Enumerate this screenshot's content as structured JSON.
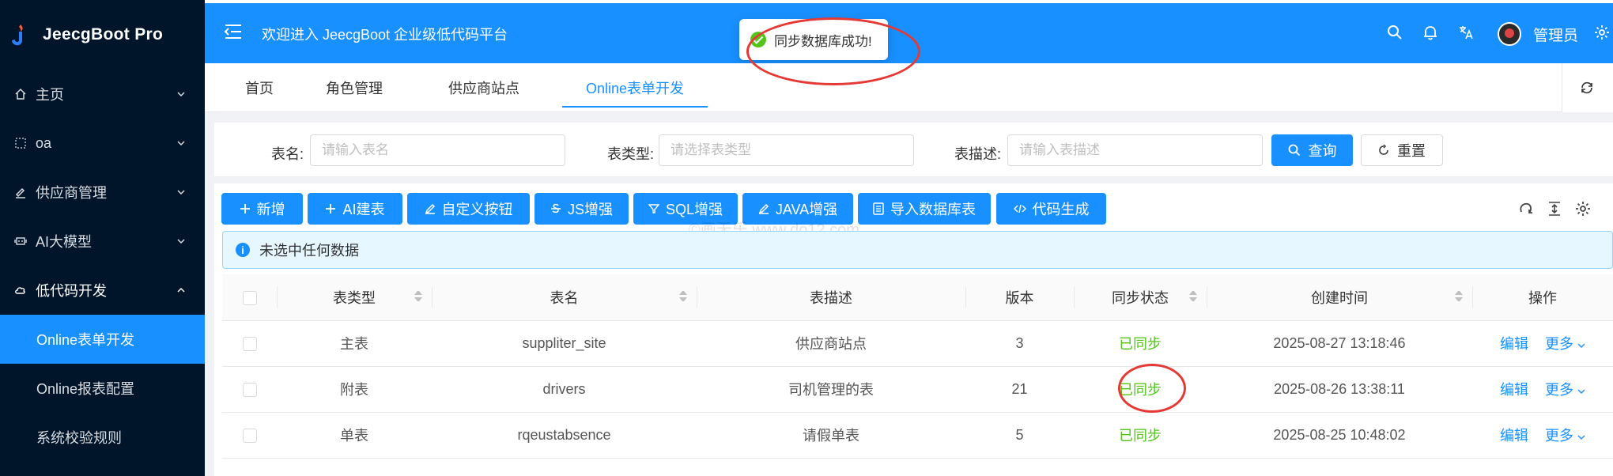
{
  "app": {
    "title": "JeecgBoot Pro",
    "welcome": "欢迎进入 JeecgBoot 企业级低代码平台",
    "user": "管理员"
  },
  "toast": {
    "message": "同步数据库成功!"
  },
  "sidebar": {
    "items": [
      {
        "label": "主页",
        "icon": "home-icon"
      },
      {
        "label": "oa",
        "icon": "grid-icon"
      },
      {
        "label": "供应商管理",
        "icon": "brush-icon"
      },
      {
        "label": "AI大模型",
        "icon": "model-icon"
      },
      {
        "label": "低代码开发",
        "icon": "cloud-icon"
      }
    ],
    "submenu": [
      {
        "label": "Online表单开发",
        "active": true
      },
      {
        "label": "Online报表配置",
        "active": false
      },
      {
        "label": "系统校验规则",
        "active": false
      }
    ]
  },
  "tabs": [
    {
      "label": "首页"
    },
    {
      "label": "角色管理"
    },
    {
      "label": "供应商站点"
    },
    {
      "label": "Online表单开发"
    }
  ],
  "search": {
    "table_name_label": "表名:",
    "table_name_placeholder": "请输入表名",
    "table_type_label": "表类型:",
    "table_type_placeholder": "请选择表类型",
    "table_desc_label": "表描述:",
    "table_desc_placeholder": "请输入表描述",
    "query_label": "查询",
    "reset_label": "重置"
  },
  "toolbar": {
    "add": "新增",
    "ai_build": "AI建表",
    "custom_button": "自定义按钮",
    "js_enhance": "JS增强",
    "sql_enhance": "SQL增强",
    "java_enhance": "JAVA增强",
    "import_db": "导入数据库表",
    "code_gen": "代码生成"
  },
  "watermark": "©画无乐 www.do12.com",
  "alert": {
    "message": "未选中任何数据"
  },
  "table": {
    "headers": [
      "表类型",
      "表名",
      "表描述",
      "版本",
      "同步状态",
      "创建时间",
      "操作"
    ],
    "rows": [
      {
        "type": "主表",
        "name": "suppliter_site",
        "desc": "供应商站点",
        "version": "3",
        "status": "已同步",
        "created": "2025-08-27 13:18:46",
        "edit": "编辑",
        "more": "更多"
      },
      {
        "type": "附表",
        "name": "drivers",
        "desc": "司机管理的表",
        "version": "21",
        "status": "已同步",
        "created": "2025-08-26 13:38:11",
        "edit": "编辑",
        "more": "更多"
      },
      {
        "type": "单表",
        "name": "rqeustabsence",
        "desc": "请假单表",
        "version": "5",
        "status": "已同步",
        "created": "2025-08-25 10:48:02",
        "edit": "编辑",
        "more": "更多"
      }
    ]
  },
  "colors": {
    "primary": "#1890ff",
    "sidebar_bg": "#001529",
    "success": "#52c41a",
    "highlight": "#e53935"
  }
}
